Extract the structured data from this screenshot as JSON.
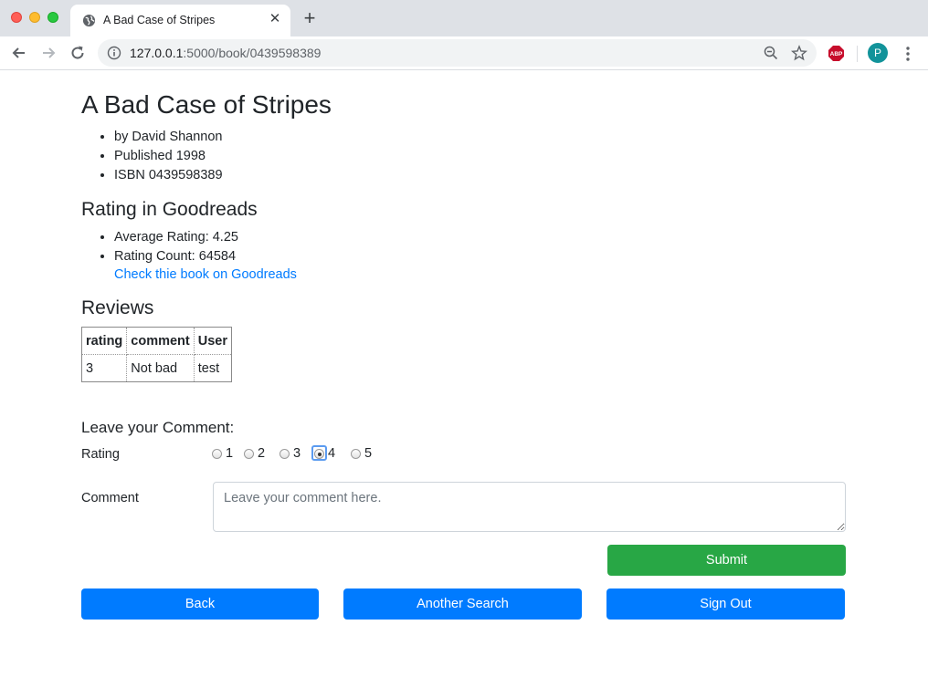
{
  "browser": {
    "tab_title": "A Bad Case of Stripes",
    "tab_close": "✕",
    "new_tab": "+",
    "url_host": "127.0.0.1",
    "url_path": ":5000/book/0439598389",
    "abp_label": "ABP",
    "profile_initial": "P"
  },
  "book": {
    "title": "A Bad Case of Stripes",
    "details": [
      "by David Shannon",
      "Published 1998",
      "ISBN 0439598389"
    ]
  },
  "goodreads": {
    "heading": "Rating in Goodreads",
    "average": "Average Rating: 4.25",
    "count": "Rating Count: 64584",
    "link_text": "Check thie book on Goodreads"
  },
  "reviews": {
    "heading": "Reviews",
    "columns": [
      "rating",
      "comment",
      "User"
    ],
    "rows": [
      [
        "3",
        "Not bad",
        "test"
      ]
    ]
  },
  "form": {
    "heading": "Leave your Comment:",
    "rating_label": "Rating",
    "rating_options": [
      "1",
      "2",
      "3",
      "4",
      "5"
    ],
    "selected_rating": "4",
    "comment_label": "Comment",
    "comment_placeholder": "Leave your comment here.",
    "submit_label": "Submit"
  },
  "nav": {
    "back_label": "Back",
    "search_label": "Another Search",
    "signout_label": "Sign Out"
  },
  "colors": {
    "primary": "#007bff",
    "success": "#28a745",
    "link": "#007bff"
  }
}
